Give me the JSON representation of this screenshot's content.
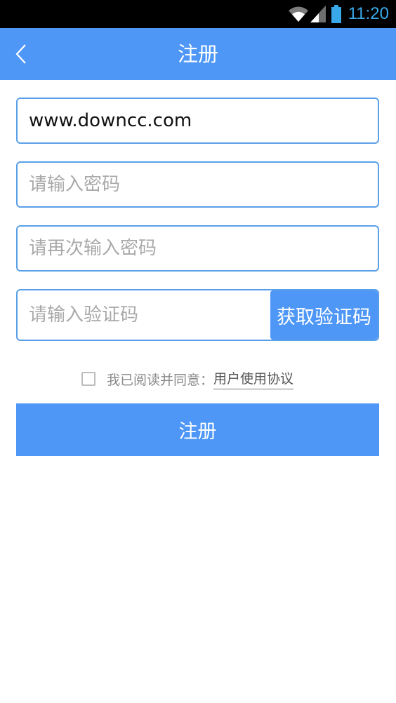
{
  "status_bar": {
    "time": "11:20",
    "icons": [
      "wifi-icon",
      "signal-icon",
      "battery-icon"
    ],
    "time_color": "#39a8e8"
  },
  "app_bar": {
    "title": "注册",
    "back_icon": "chevron-left-icon",
    "color": "#4e97f6"
  },
  "form": {
    "username": {
      "value": "www.downcc.com",
      "placeholder": ""
    },
    "password": {
      "value": "",
      "placeholder": "请输入密码"
    },
    "confirm_password": {
      "value": "",
      "placeholder": "请再次输入密码"
    },
    "verification_code": {
      "value": "",
      "placeholder": "请输入验证码"
    },
    "get_code_label": "获取验证码",
    "agreement_text": "我已阅读并同意：",
    "agreement_link": "用户使用协议",
    "agreement_checked": false,
    "register_label": "注册"
  }
}
